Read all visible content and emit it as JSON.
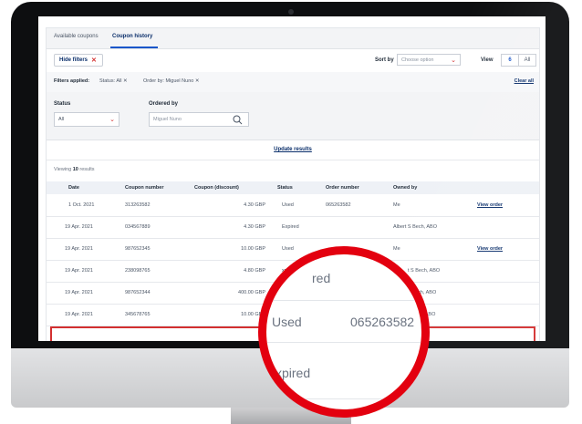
{
  "tabs": [
    {
      "label": "Available coupons",
      "active": false
    },
    {
      "label": "Coupon history",
      "active": true
    }
  ],
  "toolbar": {
    "hide_filters_label": "Hide filters",
    "sort_by_label": "Sort by",
    "sort_placeholder": "Choose option",
    "view_label": "View",
    "view_options": [
      "6",
      "All"
    ],
    "view_selected": "6"
  },
  "filters_applied": {
    "label": "Filters applied:",
    "filters": [
      "Status: All",
      "Order by: Miguel Nuno"
    ],
    "clear_all_label": "Clear all"
  },
  "filters": {
    "status": {
      "label": "Status",
      "value": "All"
    },
    "ordered_by": {
      "label": "Ordered by",
      "placeholder": "Miguel Nuno"
    }
  },
  "update_results_label": "Update results",
  "viewing": {
    "prefix": "Viewing",
    "count": "10",
    "suffix": "results"
  },
  "table": {
    "headers": [
      "Date",
      "Coupon number",
      "Coupon (discount)",
      "Status",
      "Order number",
      "Owned by"
    ],
    "rows": [
      {
        "date": "1 Oct. 2021",
        "coupon_number": "313263582",
        "discount": "4.30 GBP",
        "status": "Used",
        "order_number": "065263582",
        "owned_by": "Me",
        "action": "View order"
      },
      {
        "date": "19 Apr. 2021",
        "coupon_number": "034567889",
        "discount": "4.30 GBP",
        "status": "Expired",
        "order_number": "",
        "owned_by": "Albert S Bech, ABO",
        "action": ""
      },
      {
        "date": "19 Apr. 2021",
        "coupon_number": "987652345",
        "discount": "10.00 GBP",
        "status": "Used",
        "order_number": "",
        "owned_by": "Me",
        "action": "View order"
      },
      {
        "date": "19 Apr. 2021",
        "coupon_number": "238098765",
        "discount": "4.80 GBP",
        "status": "xpired",
        "order_number": "",
        "owned_by": "t S Bech, ABO",
        "action": ""
      },
      {
        "date": "19 Apr. 2021",
        "coupon_number": "987652344",
        "discount": "400.00 GBP",
        "status": "",
        "order_number": "",
        "owned_by": "ech, ABO",
        "action": ""
      },
      {
        "date": "19 Apr. 2021",
        "coupon_number": "345678765",
        "discount": "10.00 GBP",
        "status": "",
        "order_number": "",
        "owned_by": ", ABO",
        "action": ""
      }
    ]
  },
  "magnifier": {
    "top_text": "red",
    "status": "Used",
    "order_number": "065263582",
    "bottom_text": "xpired"
  },
  "colors": {
    "accent_red": "#e3000f",
    "navy": "#0b2f6b",
    "tab_underline": "#1a56c9"
  }
}
